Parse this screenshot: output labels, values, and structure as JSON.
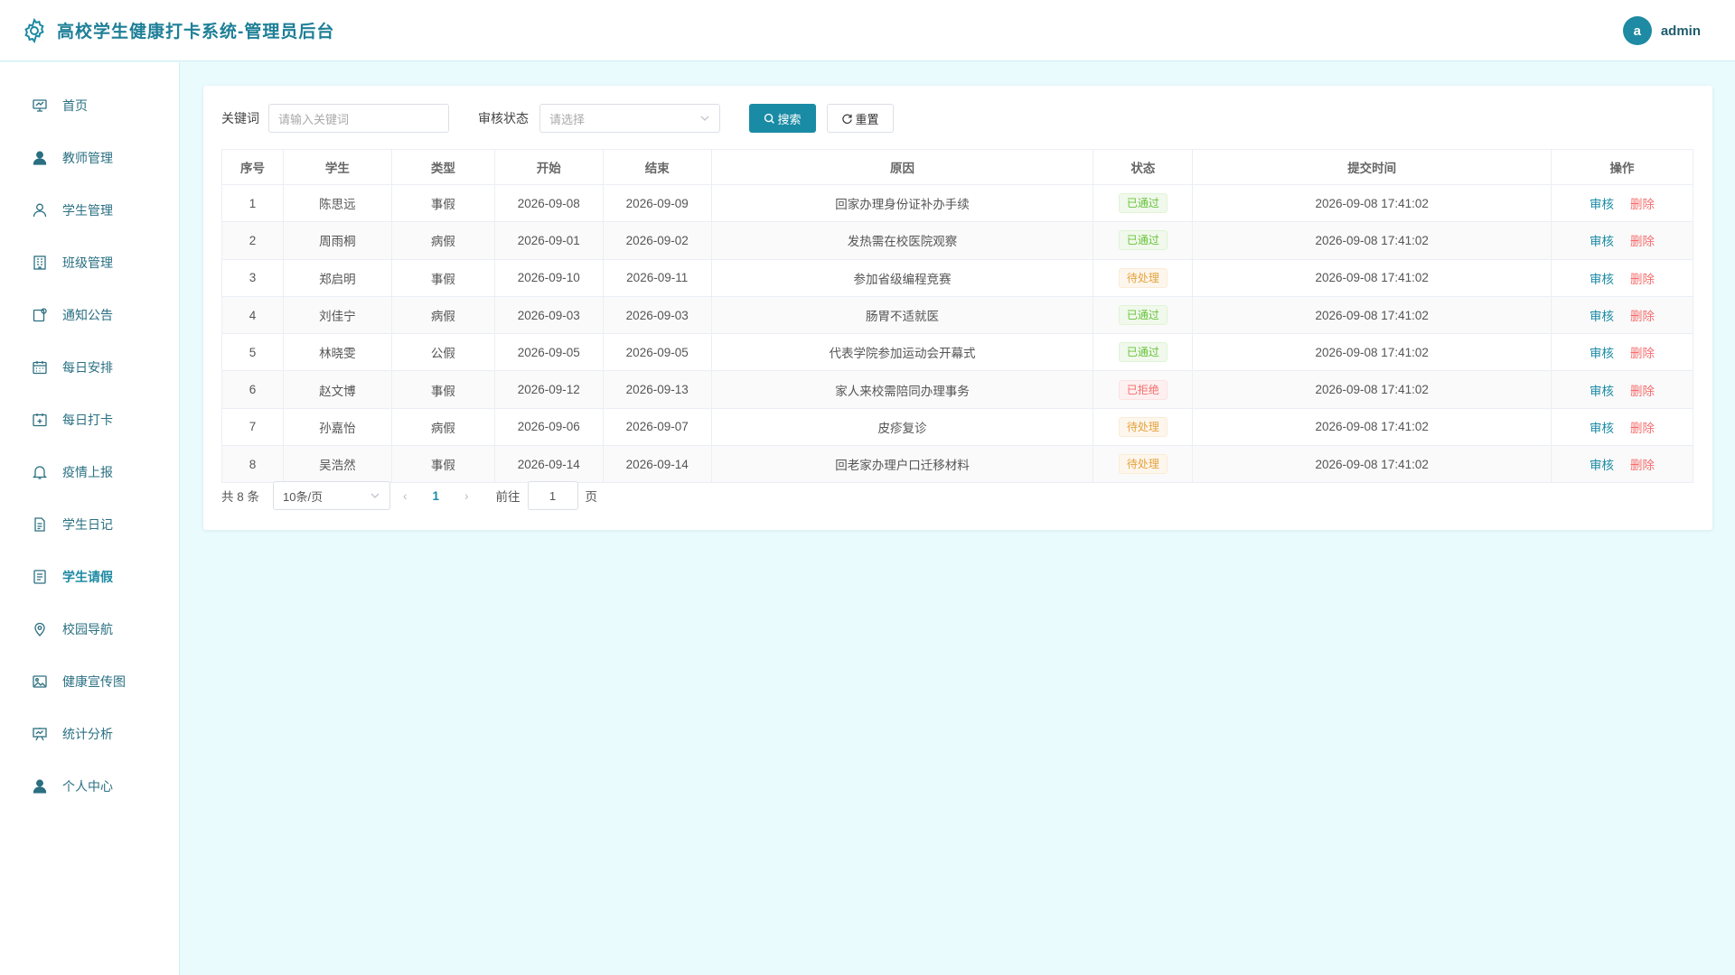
{
  "header": {
    "title": "高校学生健康打卡系统-管理员后台",
    "avatar_letter": "a",
    "username": "admin"
  },
  "sidebar": {
    "items": [
      {
        "label": "首页",
        "icon": "home-chart-icon"
      },
      {
        "label": "教师管理",
        "icon": "user-solid-icon"
      },
      {
        "label": "学生管理",
        "icon": "user-outline-icon"
      },
      {
        "label": "班级管理",
        "icon": "building-icon"
      },
      {
        "label": "通知公告",
        "icon": "notice-icon"
      },
      {
        "label": "每日安排",
        "icon": "calendar-icon"
      },
      {
        "label": "每日打卡",
        "icon": "date-check-icon"
      },
      {
        "label": "疫情上报",
        "icon": "bell-icon"
      },
      {
        "label": "学生日记",
        "icon": "document-icon"
      },
      {
        "label": "学生请假",
        "icon": "tickets-icon"
      },
      {
        "label": "校园导航",
        "icon": "location-icon"
      },
      {
        "label": "健康宣传图",
        "icon": "picture-icon"
      },
      {
        "label": "统计分析",
        "icon": "data-board-icon"
      },
      {
        "label": "个人中心",
        "icon": "user-solid-icon"
      }
    ],
    "active_index": 9
  },
  "filters": {
    "keyword_label": "关键词",
    "keyword_placeholder": "请输入关键词",
    "status_label": "审核状态",
    "status_placeholder": "请选择",
    "search_label": "搜索",
    "reset_label": "重置"
  },
  "table": {
    "columns": [
      "序号",
      "学生",
      "类型",
      "开始",
      "结束",
      "原因",
      "状态",
      "提交时间",
      "操作"
    ],
    "rows": [
      {
        "no": "1",
        "student": "陈思远",
        "type": "事假",
        "start": "2026-09-08",
        "end": "2026-09-09",
        "reason": "回家办理身份证补办手续",
        "status": "已通过",
        "status_kind": "ok",
        "submitted": "2026-09-08 17:41:02"
      },
      {
        "no": "2",
        "student": "周雨桐",
        "type": "病假",
        "start": "2026-09-01",
        "end": "2026-09-02",
        "reason": "发热需在校医院观察",
        "status": "已通过",
        "status_kind": "ok",
        "submitted": "2026-09-08 17:41:02"
      },
      {
        "no": "3",
        "student": "郑启明",
        "type": "事假",
        "start": "2026-09-10",
        "end": "2026-09-11",
        "reason": "参加省级编程竞赛",
        "status": "待处理",
        "status_kind": "wait",
        "submitted": "2026-09-08 17:41:02"
      },
      {
        "no": "4",
        "student": "刘佳宁",
        "type": "病假",
        "start": "2026-09-03",
        "end": "2026-09-03",
        "reason": "肠胃不适就医",
        "status": "已通过",
        "status_kind": "ok",
        "submitted": "2026-09-08 17:41:02"
      },
      {
        "no": "5",
        "student": "林晓雯",
        "type": "公假",
        "start": "2026-09-05",
        "end": "2026-09-05",
        "reason": "代表学院参加运动会开幕式",
        "status": "已通过",
        "status_kind": "ok",
        "submitted": "2026-09-08 17:41:02"
      },
      {
        "no": "6",
        "student": "赵文博",
        "type": "事假",
        "start": "2026-09-12",
        "end": "2026-09-13",
        "reason": "家人来校需陪同办理事务",
        "status": "已拒绝",
        "status_kind": "rej",
        "submitted": "2026-09-08 17:41:02"
      },
      {
        "no": "7",
        "student": "孙嘉怡",
        "type": "病假",
        "start": "2026-09-06",
        "end": "2026-09-07",
        "reason": "皮疹复诊",
        "status": "待处理",
        "status_kind": "wait",
        "submitted": "2026-09-08 17:41:02"
      },
      {
        "no": "8",
        "student": "吴浩然",
        "type": "事假",
        "start": "2026-09-14",
        "end": "2026-09-14",
        "reason": "回老家办理户口迁移材料",
        "status": "待处理",
        "status_kind": "wait",
        "submitted": "2026-09-08 17:41:02"
      }
    ],
    "audit_label": "审核",
    "delete_label": "删除"
  },
  "pagination": {
    "total_text": "共 8 条",
    "page_size": "10条/页",
    "current_page": "1",
    "goto_label": "前往",
    "goto_value": "1",
    "page_suffix": "页"
  },
  "colors": {
    "accent": "#1a8ba4",
    "page_bg": "#eafbfd",
    "ok": "#67c23a",
    "wait": "#e6a23c",
    "reject": "#f56c6c"
  }
}
